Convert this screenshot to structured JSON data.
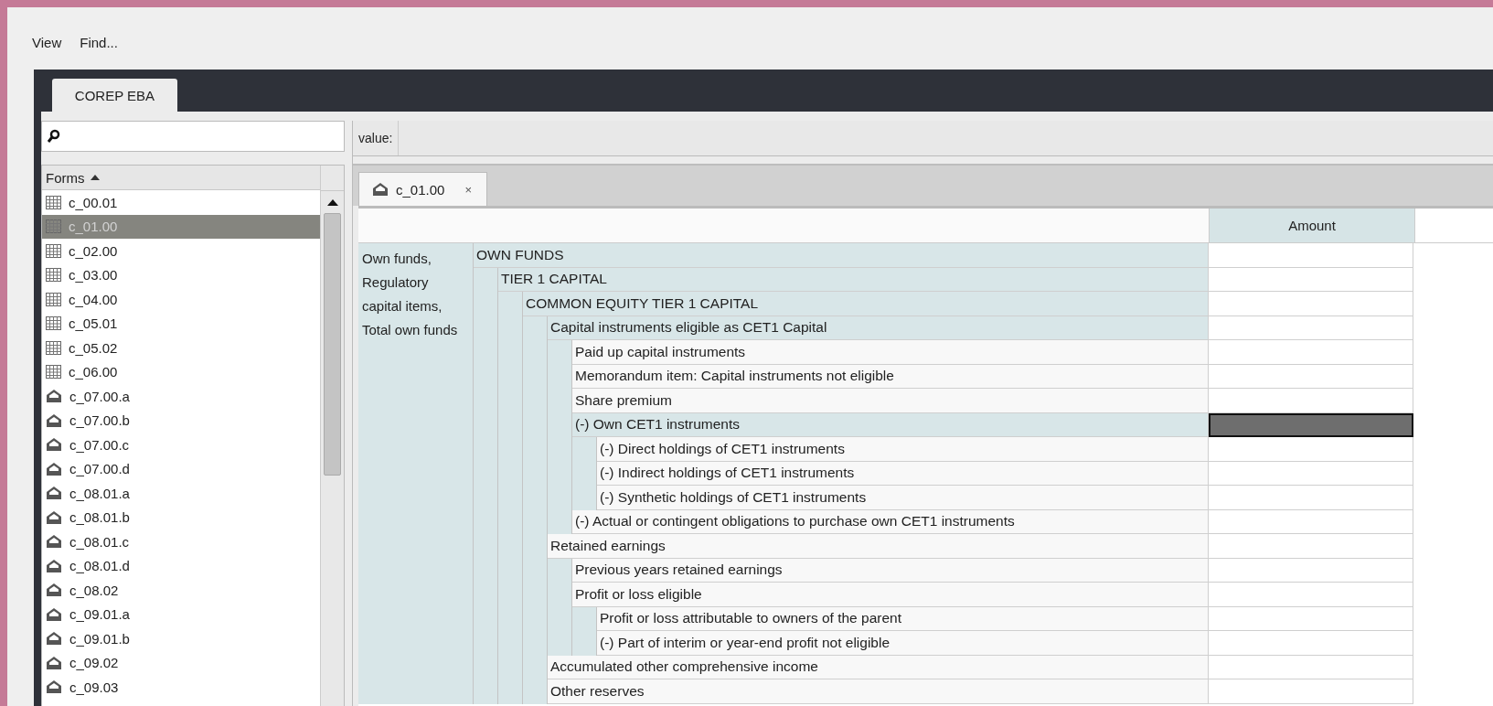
{
  "menu": [
    {
      "label": "View"
    },
    {
      "label": "Find..."
    }
  ],
  "workspace_tab": {
    "label": "COREP EBA"
  },
  "forms_list": {
    "header": "Forms",
    "items": [
      {
        "label": "c_00.01",
        "kind": "grid",
        "selected": false
      },
      {
        "label": "c_01.00",
        "kind": "grid",
        "selected": true
      },
      {
        "label": "c_02.00",
        "kind": "grid",
        "selected": false
      },
      {
        "label": "c_03.00",
        "kind": "grid",
        "selected": false
      },
      {
        "label": "c_04.00",
        "kind": "grid",
        "selected": false
      },
      {
        "label": "c_05.01",
        "kind": "grid",
        "selected": false
      },
      {
        "label": "c_05.02",
        "kind": "grid",
        "selected": false
      },
      {
        "label": "c_06.00",
        "kind": "grid",
        "selected": false
      },
      {
        "label": "c_07.00.a",
        "kind": "house",
        "selected": false
      },
      {
        "label": "c_07.00.b",
        "kind": "house",
        "selected": false
      },
      {
        "label": "c_07.00.c",
        "kind": "house",
        "selected": false
      },
      {
        "label": "c_07.00.d",
        "kind": "house",
        "selected": false
      },
      {
        "label": "c_08.01.a",
        "kind": "house",
        "selected": false
      },
      {
        "label": "c_08.01.b",
        "kind": "house",
        "selected": false
      },
      {
        "label": "c_08.01.c",
        "kind": "house",
        "selected": false
      },
      {
        "label": "c_08.01.d",
        "kind": "house",
        "selected": false
      },
      {
        "label": "c_08.02",
        "kind": "house",
        "selected": false
      },
      {
        "label": "c_09.01.a",
        "kind": "house",
        "selected": false
      },
      {
        "label": "c_09.01.b",
        "kind": "house",
        "selected": false
      },
      {
        "label": "c_09.02",
        "kind": "house",
        "selected": false
      },
      {
        "label": "c_09.03",
        "kind": "house",
        "selected": false
      }
    ]
  },
  "value_field": {
    "label": "value:"
  },
  "document_tab": {
    "label": "c_01.00",
    "close": "×"
  },
  "table": {
    "side_label": "Own funds, Regulatory capital items, Total own funds",
    "columns": [
      "Amount"
    ],
    "rows": [
      {
        "label": "OWN FUNDS",
        "shaded": true,
        "selected": false,
        "children": [
          {
            "label": "TIER 1 CAPITAL",
            "shaded": true,
            "selected": false,
            "children": [
              {
                "label": "COMMON EQUITY TIER 1 CAPITAL",
                "shaded": true,
                "selected": false,
                "children": [
                  {
                    "label": "Capital instruments eligible as CET1 Capital",
                    "shaded": true,
                    "selected": false,
                    "children": [
                      {
                        "label": "Paid up capital instruments",
                        "shaded": false,
                        "selected": false
                      },
                      {
                        "label": "Memorandum item: Capital instruments not eligible",
                        "shaded": false,
                        "selected": false
                      },
                      {
                        "label": "Share premium",
                        "shaded": false,
                        "selected": false
                      },
                      {
                        "label": "(-) Own CET1 instruments",
                        "shaded": true,
                        "selected": true,
                        "children": [
                          {
                            "label": "(-) Direct holdings of CET1 instruments",
                            "shaded": false,
                            "selected": false
                          },
                          {
                            "label": "(-) Indirect holdings of CET1 instruments",
                            "shaded": false,
                            "selected": false
                          },
                          {
                            "label": "(-) Synthetic holdings of CET1 instruments",
                            "shaded": false,
                            "selected": false
                          }
                        ]
                      },
                      {
                        "label": "(-) Actual or contingent obligations to purchase own CET1 instruments",
                        "shaded": false,
                        "selected": false
                      }
                    ]
                  },
                  {
                    "label": "Retained earnings",
                    "shaded": false,
                    "selected": false,
                    "children": [
                      {
                        "label": "Previous years retained earnings",
                        "shaded": false,
                        "selected": false
                      },
                      {
                        "label": "Profit or loss eligible",
                        "shaded": false,
                        "selected": false,
                        "children": [
                          {
                            "label": "Profit or loss attributable to owners of the parent",
                            "shaded": false,
                            "selected": false
                          },
                          {
                            "label": "(-) Part of interim or year-end profit not eligible",
                            "shaded": false,
                            "selected": false
                          }
                        ]
                      }
                    ]
                  },
                  {
                    "label": "Accumulated other comprehensive income",
                    "shaded": false,
                    "selected": false
                  },
                  {
                    "label": "Other reserves",
                    "shaded": false,
                    "selected": false
                  }
                ]
              }
            ]
          }
        ]
      }
    ]
  }
}
